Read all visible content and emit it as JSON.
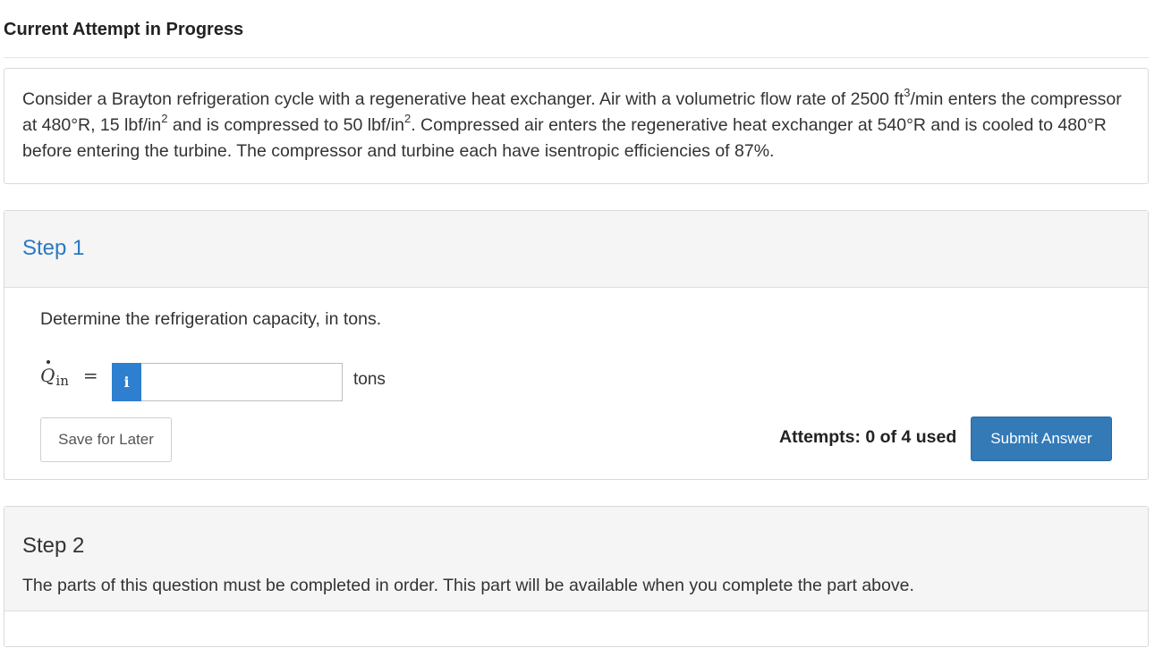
{
  "header": {
    "title": "Current Attempt in Progress"
  },
  "question": {
    "part1": "Consider a Brayton refrigeration cycle with a regenerative heat exchanger. Air with a volumetric flow rate of 2500 ft",
    "sup1": "3",
    "part2": "/min enters the compressor at 480°R, 15 lbf/in",
    "sup2": "2",
    "part3": " and is compressed to 50 lbf/in",
    "sup3": "2",
    "part4": ". Compressed air enters the regenerative heat exchanger at 540°R and is cooled to 480°R before entering the turbine.  The compressor and turbine each have isentropic efficiencies of 87%."
  },
  "step1": {
    "title": "Step 1",
    "prompt": "Determine the refrigeration capacity, in tons.",
    "variable": "Q",
    "subscript": "in",
    "equals": "=",
    "info_icon": "info-icon",
    "info_glyph": "i",
    "input_value": "",
    "unit": "tons",
    "save_label": "Save for Later",
    "attempts_text": "Attempts: 0 of 4 used",
    "submit_label": "Submit Answer"
  },
  "step2": {
    "title": "Step 2",
    "note": "The parts of this question must be completed in order. This part will be available when you complete the part above."
  },
  "colors": {
    "link_blue": "#2b79c2",
    "submit_blue": "#337ab7",
    "info_blue": "#2f7fd0",
    "panel_gray": "#f5f5f5"
  }
}
